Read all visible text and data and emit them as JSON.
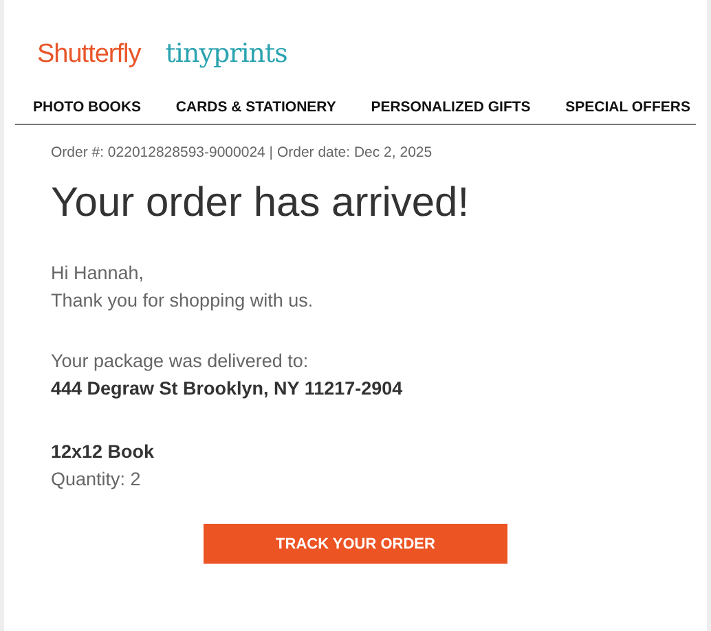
{
  "brands": [
    "Shutterfly",
    "tinyprints"
  ],
  "nav": [
    "PHOTO BOOKS",
    "CARDS & STATIONERY",
    "PERSONALIZED GIFTS",
    "SPECIAL OFFERS"
  ],
  "order_line": "Order #: 022012828593-9000024 | Order date: Dec 2, 2025",
  "heading": "Your order has arrived!",
  "greeting": [
    "Hi Hannah,",
    "Thank you for shopping with us."
  ],
  "delivery": {
    "label": "Your package was delivered to:",
    "address": "444 Degraw St Brooklyn, NY 11217-2904"
  },
  "item": {
    "name": "12x12 Book",
    "quantity": "Quantity: 2"
  },
  "button": "TRACK YOUR ORDER"
}
